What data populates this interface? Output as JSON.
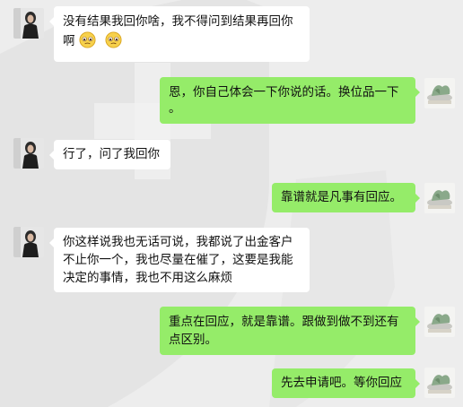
{
  "messages": [
    {
      "side": "left",
      "avatar": "woman-avatar-icon",
      "lines": [
        "没有结果我回你啥，我不得问到结果再回你",
        "啊"
      ],
      "emoji": [
        "pleading-face-icon",
        "pleading-face-icon"
      ]
    },
    {
      "side": "right",
      "avatar": "plant-desk-avatar-icon",
      "lines": [
        "恩，你自己体会一下你说的话。换位品一下",
        "。"
      ]
    },
    {
      "side": "left",
      "avatar": "woman-avatar-icon",
      "lines": [
        "行了，问了我回你"
      ]
    },
    {
      "side": "right",
      "avatar": "plant-desk-avatar-icon",
      "lines": [
        "靠谱就是凡事有回应。"
      ]
    },
    {
      "side": "left",
      "avatar": "woman-avatar-icon",
      "lines": [
        "你这样说我也无话可说，我都说了出金客户",
        "不止你一个，我也尽量在催了，这要是我能",
        "决定的事情，我也不用这么麻烦"
      ]
    },
    {
      "side": "right",
      "avatar": "plant-desk-avatar-icon",
      "lines": [
        "重点在回应，就是靠谱。跟做到做不到还有",
        "点区别。"
      ]
    },
    {
      "side": "right",
      "avatar": "plant-desk-avatar-icon",
      "lines": [
        "先去申请吧。等你回应"
      ]
    }
  ],
  "colors": {
    "background": "#ededed",
    "bubble_left": "#ffffff",
    "bubble_right": "#95ec69"
  }
}
